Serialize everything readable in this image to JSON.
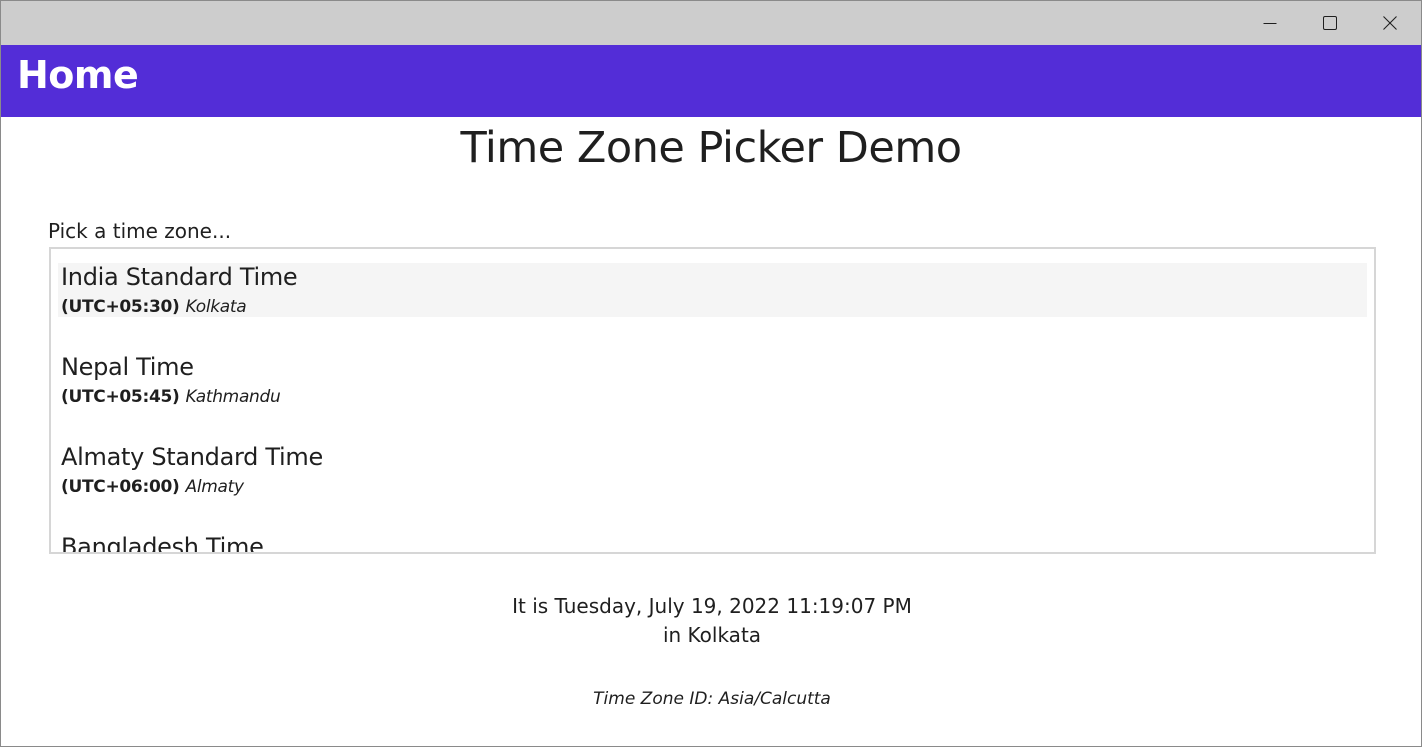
{
  "window": {
    "minimize_icon": "minimize-icon",
    "maximize_icon": "maximize-icon",
    "close_icon": "close-icon"
  },
  "header": {
    "title": "Home",
    "background": "#532dd7"
  },
  "main": {
    "title": "Time Zone Picker Demo",
    "picker_label": "Pick a time zone...",
    "timezones": [
      {
        "name": "India Standard Time",
        "offset": "(UTC+05:30)",
        "city": "Kolkata",
        "selected": true
      },
      {
        "name": "Nepal Time",
        "offset": "(UTC+05:45)",
        "city": "Kathmandu",
        "selected": false
      },
      {
        "name": "Almaty Standard Time",
        "offset": "(UTC+06:00)",
        "city": "Almaty",
        "selected": false
      },
      {
        "name": "Bangladesh Time",
        "offset": "",
        "city": "",
        "selected": false
      }
    ],
    "current_time": "It is Tuesday, July 19, 2022 11:19:07 PM",
    "current_place": "in Kolkata",
    "timezone_id": "Time Zone ID: Asia/Calcutta"
  }
}
